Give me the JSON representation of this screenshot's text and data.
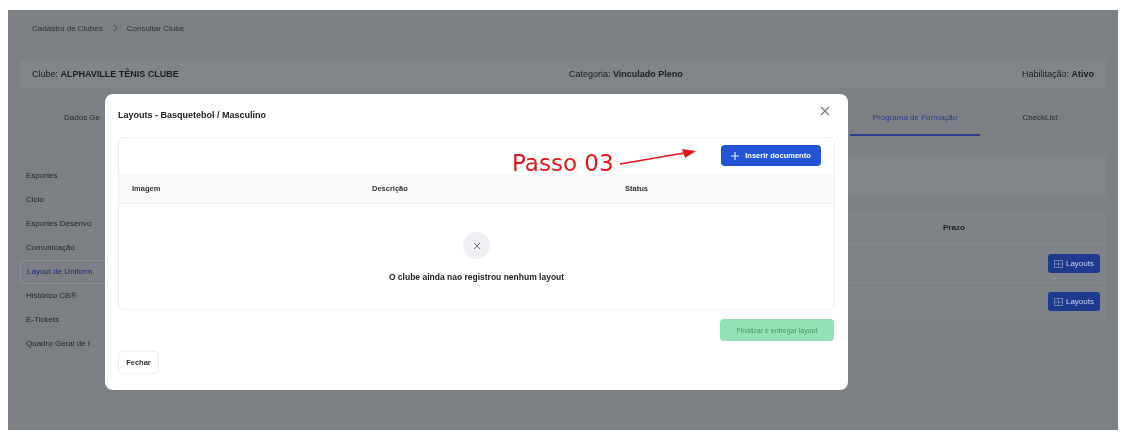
{
  "breadcrumb": [
    "Cadastro de Clubes",
    "Consultar Clube"
  ],
  "club_header": [
    "Clube: **ALPHAVILLE TÊNIS CLUBE**",
    "Categoria: **Vinculado Pleno**",
    "Habilitação: **Ativo**"
  ],
  "tabs": [
    {
      "label": "Dados Ge",
      "selected": false
    },
    {
      "label": "Programa de Formação",
      "selected": true
    },
    {
      "label": "CheckList",
      "selected": false
    }
  ],
  "sidebar": {
    "items": [
      {
        "label": "Esportes",
        "selected": false
      },
      {
        "label": "Ciclo",
        "selected": false
      },
      {
        "label": "Esportes Desenvo",
        "selected": false
      },
      {
        "label": "Comunicação",
        "selected": false
      },
      {
        "label": "Layout de Uniform",
        "selected": true
      },
      {
        "label": "Histórico CB®",
        "selected": false
      },
      {
        "label": "E-Tickets",
        "selected": false
      },
      {
        "label": "Quadro Geral de I",
        "selected": false
      }
    ]
  },
  "content_table": {
    "column_header": "Prazo",
    "rows": [
      {
        "button": "Layouts"
      },
      {
        "button": "Layouts"
      }
    ]
  },
  "modal": {
    "title": "Layouts - Basquetebol / Masculino",
    "insert_button": "Inserir documento",
    "columns": [
      "Imagem",
      "Descrição",
      "Status"
    ],
    "empty_message": "O clube ainda nao registrou nenhum layout",
    "finish_button": {
      "label": "Finalizar e entregar layout",
      "disabled": true
    },
    "close_button": "Fechar"
  },
  "annotation": {
    "text": "Passo 03"
  }
}
